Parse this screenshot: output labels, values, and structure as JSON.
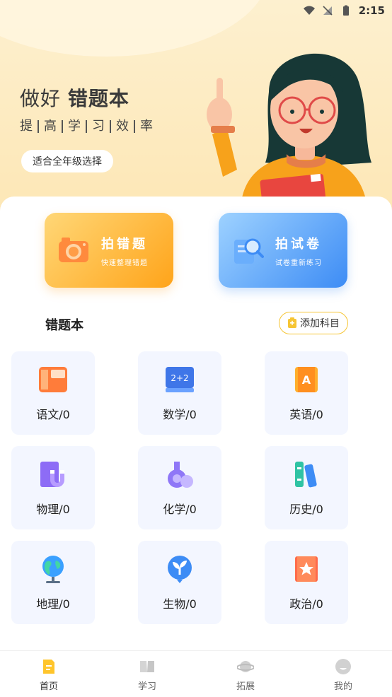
{
  "status_bar": {
    "time": "2:15"
  },
  "hero": {
    "title_prefix": "做好",
    "title_bold": "错题本",
    "subtitle": [
      "提",
      "高",
      "学",
      "习",
      "效",
      "率"
    ],
    "grade_pill": "适合全年级选择"
  },
  "actions": [
    {
      "title": "拍错题",
      "subtitle": "快速整理错题",
      "icon": "camera-icon"
    },
    {
      "title": "拍试卷",
      "subtitle": "试卷重新练习",
      "icon": "paper-search-icon"
    }
  ],
  "section": {
    "title": "错题本",
    "add_label": "添加科目"
  },
  "subjects": [
    {
      "label": "语文/0",
      "icon": "chinese-book-icon"
    },
    {
      "label": "数学/0",
      "icon": "math-icon"
    },
    {
      "label": "英语/0",
      "icon": "english-icon"
    },
    {
      "label": "物理/0",
      "icon": "physics-magnet-icon"
    },
    {
      "label": "化学/0",
      "icon": "chemistry-flask-icon"
    },
    {
      "label": "历史/0",
      "icon": "history-books-icon"
    },
    {
      "label": "地理/0",
      "icon": "globe-icon"
    },
    {
      "label": "生物/0",
      "icon": "plant-icon"
    },
    {
      "label": "政治/0",
      "icon": "star-book-icon"
    }
  ],
  "nav": [
    {
      "label": "首页",
      "icon": "home-icon",
      "active": true
    },
    {
      "label": "学习",
      "icon": "book-icon",
      "active": false
    },
    {
      "label": "拓展",
      "icon": "planet-icon",
      "active": false
    },
    {
      "label": "我的",
      "icon": "profile-icon",
      "active": false
    }
  ],
  "colors": {
    "accent_orange": "#ffa41a",
    "accent_blue": "#3d8cf5",
    "tile_bg": "#f3f6ff",
    "add_border": "#f6c534"
  }
}
